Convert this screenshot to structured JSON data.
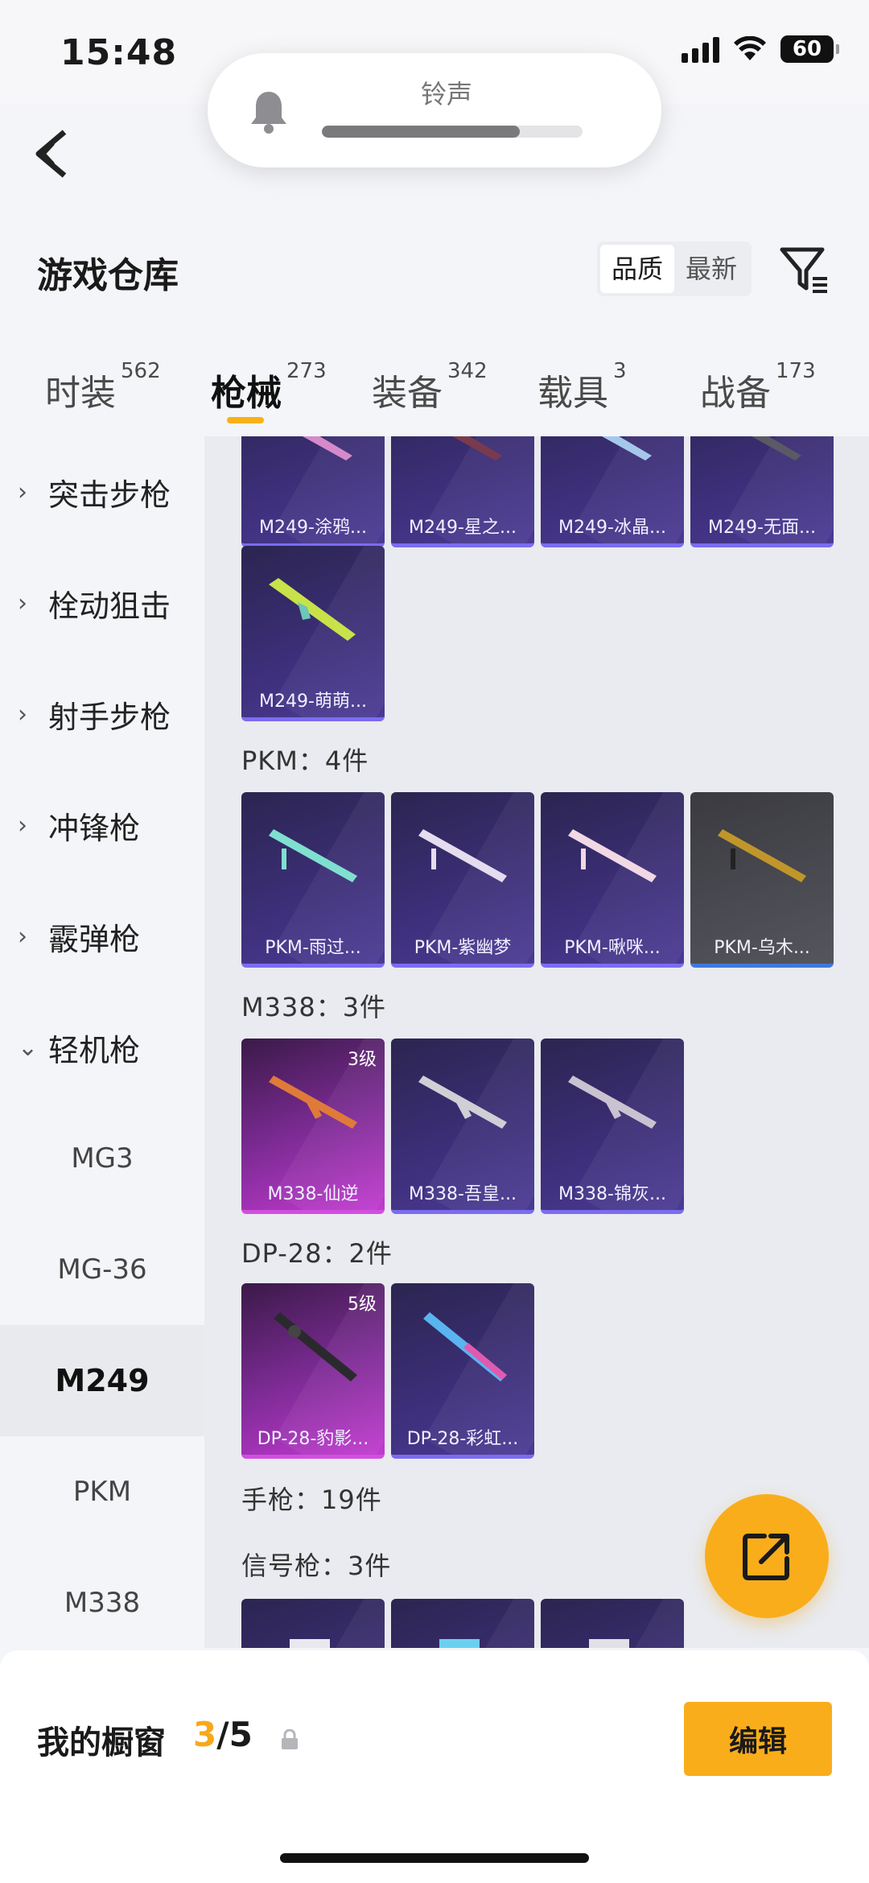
{
  "status_bar": {
    "time": "15:48",
    "battery": "60"
  },
  "volume_hud": {
    "label": "铃声",
    "level": 0.76
  },
  "header": {
    "title": "游戏仓库",
    "sort": [
      "品质",
      "最新"
    ],
    "sort_active": 0
  },
  "tabs": [
    {
      "label": "时装",
      "count": "562"
    },
    {
      "label": "枪械",
      "count": "273"
    },
    {
      "label": "装备",
      "count": "342"
    },
    {
      "label": "载具",
      "count": "3"
    },
    {
      "label": "战备",
      "count": "173"
    }
  ],
  "active_tab": 1,
  "sidebar": {
    "categories": [
      "突击步枪",
      "栓动狙击",
      "射手步枪",
      "冲锋枪",
      "霰弹枪",
      "轻机枪"
    ],
    "subitems": [
      "MG3",
      "MG-36",
      "M249",
      "PKM",
      "M338"
    ],
    "active_sub": "M249"
  },
  "groups": {
    "m249_row1": [
      "M249-涂鸦...",
      "M249-星之...",
      "M249-冰晶...",
      "M249-无面..."
    ],
    "m249_row2": [
      "M249-萌萌..."
    ],
    "pkm": {
      "title": "PKM：4件",
      "items": [
        "PKM-雨过...",
        "PKM-紫幽梦",
        "PKM-啾咪...",
        "PKM-乌木..."
      ]
    },
    "m338": {
      "title": "M338：3件",
      "items": [
        "M338-仙逆",
        "M338-吾皇...",
        "M338-锦灰..."
      ],
      "level": "3级"
    },
    "dp28": {
      "title": "DP-28：2件",
      "items": [
        "DP-28-豹影...",
        "DP-28-彩虹..."
      ],
      "level": "5级"
    },
    "pistol": {
      "title": "手枪：19件"
    },
    "flare": {
      "title": "信号枪：3件"
    }
  },
  "bottom": {
    "showcase_label": "我的橱窗",
    "showcase_current": "3",
    "showcase_total": "/5",
    "edit_label": "编辑"
  },
  "icons": [
    "bell-icon",
    "back-icon",
    "filter-icon",
    "chevron-right-icon",
    "chevron-down-icon",
    "share-icon",
    "lock-icon",
    "gun-icon"
  ],
  "colors": {
    "accent": "#f9ad1b",
    "card_purple": "#3d2f7a",
    "card_pink": "#c23ad0",
    "card_grey": "#55555d"
  }
}
